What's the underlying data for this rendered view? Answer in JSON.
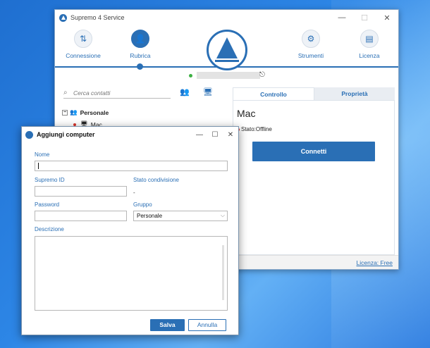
{
  "main_window": {
    "title": "Supremo 4 Service",
    "controls": {
      "minimize": "—",
      "maximize": "☐",
      "close": "✕"
    },
    "nav": [
      {
        "label": "Connessione",
        "icon": "transfer-arrows-icon",
        "glyph": "⇅"
      },
      {
        "label": "Rubrica",
        "icon": "person-icon",
        "glyph": "👤"
      },
      {
        "label": "Strumenti",
        "icon": "gear-icon",
        "glyph": "⚙"
      },
      {
        "label": "Licenza",
        "icon": "document-icon",
        "glyph": "▤"
      }
    ],
    "search_placeholder": "Cerca contatti",
    "add_contact_glyph": "👥",
    "add_computer_glyph": "🖥",
    "tree": {
      "group": "Personale",
      "items": [
        {
          "name": "Mac"
        }
      ]
    },
    "tabs": [
      {
        "label": "Controllo"
      },
      {
        "label": "Proprietà"
      }
    ],
    "selected_computer": "Mac",
    "status_text": "Stato:Offline",
    "connect_label": "Connetti",
    "license_link": "Licenza: Free",
    "colors": {
      "accent": "#2a6fb5",
      "online": "#3cb043",
      "offline": "#d9342b"
    }
  },
  "dialog": {
    "title": "Aggiungi computer",
    "controls": {
      "minimize": "—",
      "maximize": "☐",
      "close": "✕"
    },
    "labels": {
      "name": "Nome",
      "supremo_id": "Supremo ID",
      "share_status": "Stato condivisione",
      "password": "Password",
      "group": "Gruppo",
      "description": "Descrizione"
    },
    "values": {
      "name": "",
      "supremo_id": "",
      "share_status": "-",
      "password": "",
      "group": "Personale",
      "description": ""
    },
    "save_label": "Salva",
    "cancel_label": "Annulla"
  }
}
